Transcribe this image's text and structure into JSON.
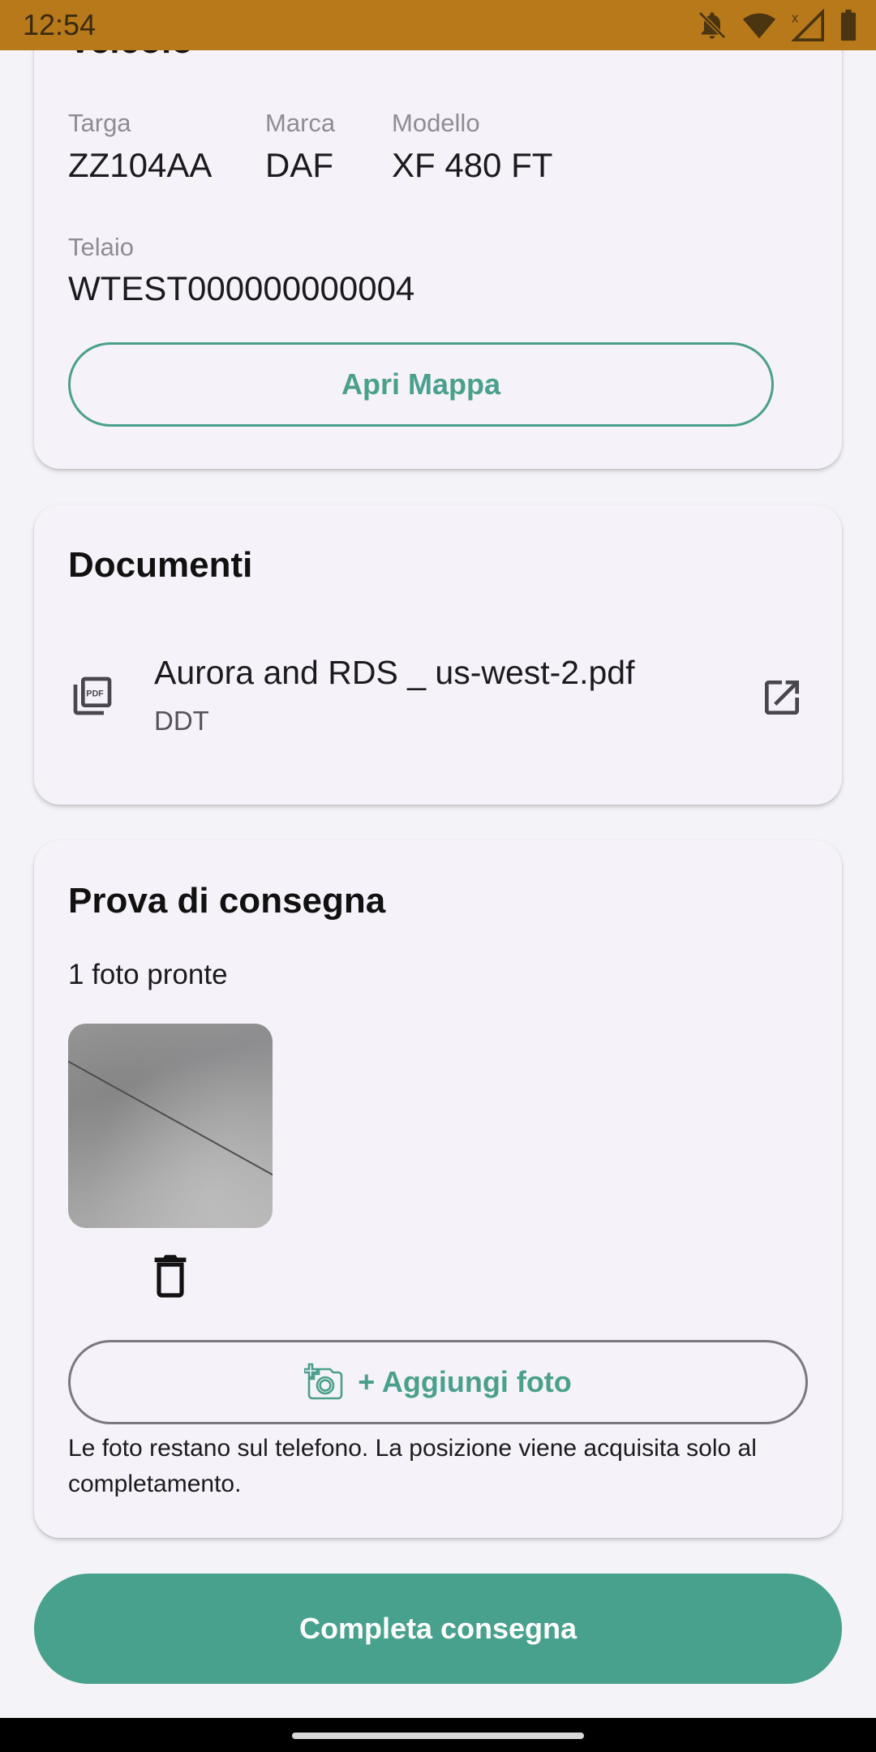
{
  "status_bar": {
    "time": "12:54",
    "icons": [
      "bell-off-icon",
      "wifi-icon",
      "signal-icon",
      "battery-icon"
    ],
    "background_color": "#b8791a"
  },
  "vehicle_card": {
    "title": "Veicolo",
    "plate_label": "Targa",
    "plate_value": "ZZ104AA",
    "brand_label": "Marca",
    "brand_value": "DAF",
    "model_label": "Modello",
    "model_value": "XF 480 FT",
    "chassis_label": "Telaio",
    "chassis_value": "WTEST000000000004",
    "map_button_label": "Apri Mappa"
  },
  "documents_card": {
    "title": "Documenti",
    "items": [
      {
        "name": "Aurora and RDS _ us-west-2.pdf",
        "type": "DDT",
        "icon": "pdf-icon",
        "action_icon": "open-external-icon"
      }
    ]
  },
  "proof_card": {
    "title": "Prova di consegna",
    "photo_count_text": "1 foto pronte",
    "add_photo_label": "+ Aggiungi foto",
    "note": "Le foto restano sul telefono. La posizione viene acquisita solo al completamento."
  },
  "complete_button_label": "Completa consegna",
  "colors": {
    "accent": "#47a18d",
    "card_background": "#f6f2f9",
    "page_background": "#f4f3f7"
  }
}
